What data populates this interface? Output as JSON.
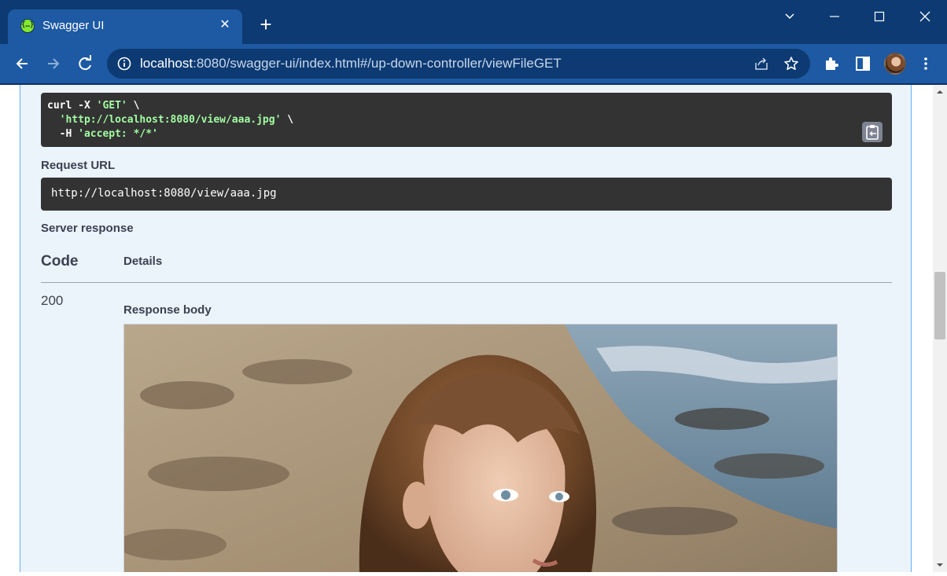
{
  "browser": {
    "tab_title": "Swagger UI",
    "favicon_glyph": "{…}",
    "new_tab_glyph": "+",
    "close_glyph": "✕",
    "address": {
      "host": "localhost",
      "path": ":8080/swagger-ui/index.html#/up-down-controller/viewFileGET"
    }
  },
  "curl": {
    "line1_cmd": "curl -X ",
    "line1_method": "'GET'",
    "line1_tail": " \\",
    "line2_indent": "  ",
    "line2_url": "'http://localhost:8080/view/aaa.jpg'",
    "line2_tail": " \\",
    "line3_cmd": "  -H ",
    "line3_header": "'accept: */*'"
  },
  "request_url": {
    "label": "Request URL",
    "value": "http://localhost:8080/view/aaa.jpg"
  },
  "server_response": {
    "label": "Server response",
    "columns": {
      "code": "Code",
      "details": "Details"
    },
    "rows": [
      {
        "code": "200",
        "body_label": "Response body"
      }
    ]
  },
  "colors": {
    "chrome_dark": "#0d3a72",
    "chrome_light": "#1d5aa3",
    "opblock_bg": "#ebf3fb",
    "opblock_border": "#61affe",
    "code_bg": "#333333",
    "string_green": "#a2fca2"
  }
}
